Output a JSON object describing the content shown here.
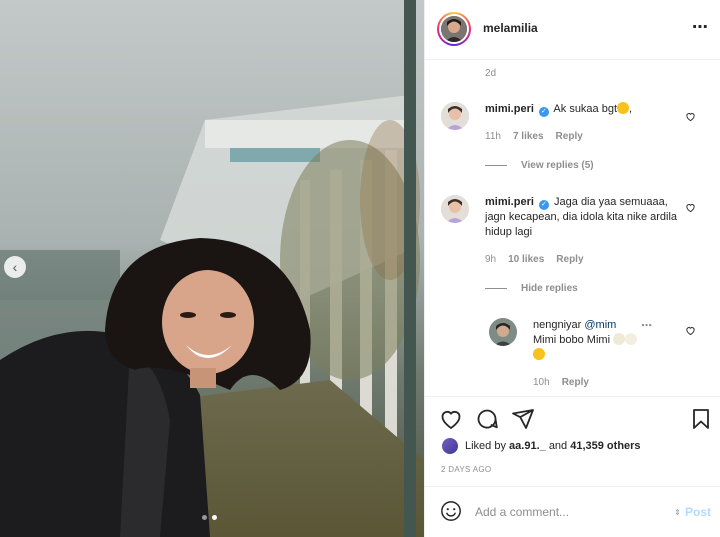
{
  "post": {
    "username": "melamilia",
    "more_icon": "⋯"
  },
  "carousel": {
    "prev_icon": "‹",
    "total": 2,
    "active_index": 1
  },
  "comments": {
    "top_time": "2d",
    "items": [
      {
        "username": "mimi.peri",
        "verified": true,
        "text": "Ak sukaa bgt",
        "text_suffix": ",",
        "emoji": "star-struck-emoji",
        "time": "11h",
        "likes": "7 likes",
        "reply_label": "Reply",
        "replies_toggle": "View replies (5)"
      },
      {
        "username": "mimi.peri",
        "verified": true,
        "text": "Jaga dia yaa semuaaa, jagn kecapean, dia idola kita nike ardila hidup lagi",
        "time": "9h",
        "likes": "10 likes",
        "reply_label": "Reply",
        "replies_toggle": "Hide replies"
      }
    ],
    "reply": {
      "username": "nengniyar",
      "mention": "@mim",
      "text": "Mimi bobo Mimi",
      "time": "10h",
      "reply_label": "Reply"
    }
  },
  "actions": {
    "liked_prefix": "Liked by ",
    "liked_user": "aa.91._",
    "liked_middle": " and ",
    "liked_count": "41,359 others",
    "date": "2 DAYS AGO"
  },
  "add_comment": {
    "placeholder": "Add a comment...",
    "post_label": "Post"
  },
  "colors": {
    "verified": "#3897f0",
    "link_blue": "#00376b",
    "post_disabled": "#b3dbff"
  }
}
